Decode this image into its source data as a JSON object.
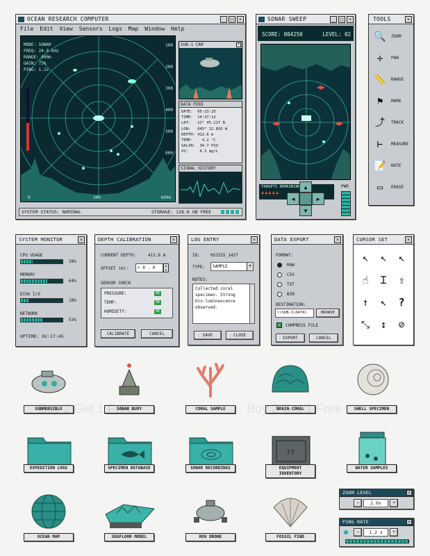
{
  "watermark": "Buy 2 Get 1 Free",
  "main": {
    "title": "OCEAN RESEARCH COMPUTER",
    "menu": [
      "File",
      "Edit",
      "View",
      "Sensors",
      "Logs",
      "Map",
      "Window",
      "Help"
    ],
    "readout": [
      "MODE: SONAR",
      "FREQ: 24.0 kHz",
      "RANGE: 600m",
      "GAIN: 72%",
      "PING: 1.2s"
    ],
    "range_labels": [
      "100",
      "200",
      "300",
      "400",
      "500",
      "600"
    ],
    "bottom_labels": [
      "0",
      "300",
      "600m"
    ],
    "status": "SYSTEM STATUS: NOMINAL",
    "storage": "STORAGE: 128.6 GB FREE",
    "cam_title": "SUB-1 CAM",
    "feed_title": "DATA FEED",
    "feed": [
      "DATE:  05-23-25",
      "TIME:  14:37:12",
      "LAT:   12° 45.217 N",
      "LON:   045° 12.893 W",
      "DEPTH: 412.6 m",
      "TEMP:    4.2 °C",
      "SALIN:  34.7 PSU",
      "O2:     6.1 mg/L"
    ],
    "signal_title": "SIGNAL HISTORY"
  },
  "sweep": {
    "title": "SONAR SWEEP",
    "score": "SCORE: 004250",
    "level": "LEVEL: 02",
    "targets": "TARGETS REMAINING",
    "pwr": "PWR"
  },
  "tools": {
    "title": "TOOLS",
    "items": [
      {
        "label": "ZOOM",
        "icon": "magnifier-icon"
      },
      {
        "label": "PAN",
        "icon": "crosshair-icon"
      },
      {
        "label": "RANGE",
        "icon": "ruler-icon"
      },
      {
        "label": "MARK",
        "icon": "flag-icon"
      },
      {
        "label": "TRACK",
        "icon": "track-icon"
      },
      {
        "label": "MEASURE",
        "icon": "caliper-icon"
      },
      {
        "label": "NOTE",
        "icon": "notepad-icon"
      },
      {
        "label": "ERASE",
        "icon": "eraser-icon"
      }
    ]
  },
  "sysmon": {
    "title": "SYSTEM MONITOR",
    "rows": [
      {
        "label": "CPU USAGE",
        "value": "28%",
        "pct": 0.28
      },
      {
        "label": "MEMORY",
        "value": "64%",
        "pct": 0.64
      },
      {
        "label": "DISK I/O",
        "value": "18%",
        "pct": 0.18
      },
      {
        "label": "NETWORK",
        "value": "53%",
        "pct": 0.53
      }
    ],
    "uptime": "UPTIME: 02:17:45"
  },
  "depth": {
    "title": "DEPTH CALIBRATION",
    "current_label": "CURRENT DEPTH:",
    "current": "412.6 m",
    "offset_label": "OFFSET (m):",
    "offset": "+ 0 . 0",
    "check": "SENSOR CHECK",
    "sensors": [
      {
        "label": "PRESSURE:",
        "status": "OK"
      },
      {
        "label": "TEMP:",
        "status": "OK"
      },
      {
        "label": "HUMIDITY:",
        "status": "OK"
      }
    ],
    "calibrate": "CALIBRATE",
    "cancel": "CANCEL"
  },
  "log": {
    "title": "LOG ENTRY",
    "id_label": "ID:",
    "id": "052325_1437",
    "type_label": "TYPE:",
    "type": "SAMPLE",
    "notes_label": "NOTES:",
    "notes": "Collected coral specimen. Strong bio-luminescence observed.",
    "save": "SAVE",
    "close": "CLOSE"
  },
  "export": {
    "title": "DATA EXPORT",
    "format": "FORMAT:",
    "options": [
      "RAW",
      "CSV",
      "TXT",
      "BIN"
    ],
    "selected": "RAW",
    "dest_label": "DESTINATION:",
    "dest": "\\\\SUB-1\\DATA\\",
    "browse": "BROWSE",
    "compress": "COMPRESS FILE",
    "export_btn": "EXPORT",
    "cancel": "CANCEL"
  },
  "cursors": {
    "title": "CURSOR SET"
  },
  "icons": [
    {
      "label": "SUBMERSIBLE",
      "icon": "submersible-icon"
    },
    {
      "label": "SONAR BUOY",
      "icon": "sonar-buoy-icon"
    },
    {
      "label": "CORAL SAMPLE",
      "icon": "coral-icon"
    },
    {
      "label": "BRAIN CORAL",
      "icon": "brain-coral-icon"
    },
    {
      "label": "SHELL SPECIMEN",
      "icon": "shell-icon"
    },
    {
      "label": "EXPEDITION LOGS",
      "icon": "folder-icon"
    },
    {
      "label": "SPECIMEN DATABASE",
      "icon": "fish-folder-icon"
    },
    {
      "label": "SONAR RECORDINGS",
      "icon": "sonar-folder-icon"
    },
    {
      "label": "EQUIPMENT INVENTORY",
      "icon": "crate-icon"
    },
    {
      "label": "WATER SAMPLES",
      "icon": "water-jar-icon"
    },
    {
      "label": "OCEAN MAP",
      "icon": "globe-icon"
    },
    {
      "label": "SEAFLOOR MODEL",
      "icon": "terrain-icon"
    },
    {
      "label": "ROV DRONE",
      "icon": "rov-icon"
    },
    {
      "label": "FOSSIL FIND",
      "icon": "fossil-shell-icon"
    }
  ],
  "zoom": {
    "title": "ZOOM LEVEL",
    "value": "2.0x"
  },
  "ping": {
    "title": "PING RATE",
    "value": "1.2 s"
  },
  "colors": {
    "titlebar": "#1d4a5a",
    "screen": "#0a2a2f",
    "accent": "#2cae9f"
  }
}
